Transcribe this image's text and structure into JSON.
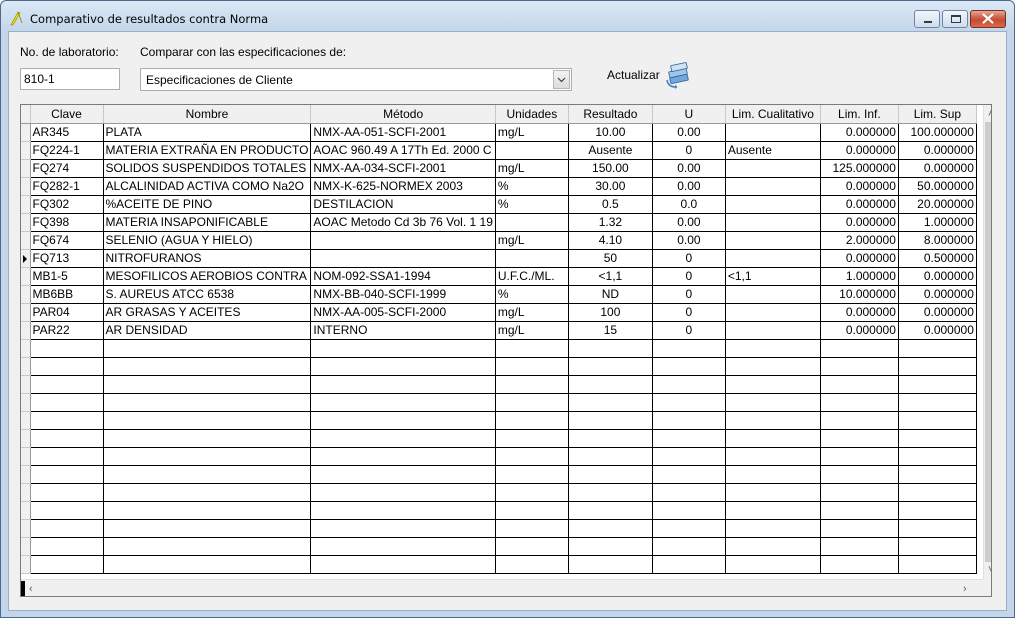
{
  "window": {
    "title": "Comparativo de resultados contra Norma"
  },
  "form": {
    "lab_label": "No. de laboratorio:",
    "lab_value": "810-1",
    "spec_label": "Comparar con las especificaciones de:",
    "spec_value": "Especificaciones de Cliente",
    "update_label": "Actualizar"
  },
  "grid": {
    "columns": [
      "Clave",
      "Nombre",
      "Método",
      "Unidades",
      "Resultado",
      "U",
      "Lim. Cualitativo",
      "Lim. Inf.",
      "Lim. Sup"
    ],
    "current_row": 7,
    "rows": [
      [
        "AR345",
        "PLATA",
        "NMX-AA-051-SCFI-2001",
        "mg/L",
        "10.00",
        "0.00",
        "",
        "0.000000",
        "100.000000"
      ],
      [
        "FQ224-1",
        "MATERIA EXTRAÑA EN PRODUCTO",
        "AOAC 960.49 A 17Th Ed. 2000 C",
        "",
        "Ausente",
        "0",
        "Ausente",
        "0.000000",
        "0.000000"
      ],
      [
        "FQ274",
        "SOLIDOS SUSPENDIDOS TOTALES",
        "NMX-AA-034-SCFI-2001",
        "mg/L",
        "150.00",
        "0.00",
        "",
        "125.000000",
        "0.000000"
      ],
      [
        "FQ282-1",
        "ALCALINIDAD ACTIVA COMO Na2O",
        "NMX-K-625-NORMEX 2003",
        "%",
        "30.00",
        "0.00",
        "",
        "0.000000",
        "50.000000"
      ],
      [
        "FQ302",
        "%ACEITE DE PINO",
        "DESTILACION",
        "%",
        "0.5",
        "0.0",
        "",
        "0.000000",
        "20.000000"
      ],
      [
        "FQ398",
        "MATERIA INSAPONIFICABLE",
        "AOAC Metodo Cd 3b 76 Vol. 1 19",
        "",
        "1.32",
        "0.00",
        "",
        "0.000000",
        "1.000000"
      ],
      [
        "FQ674",
        "SELENIO (AGUA Y HIELO)",
        "",
        "mg/L",
        "4.10",
        "0.00",
        "",
        "2.000000",
        "8.000000"
      ],
      [
        "FQ713",
        "NITROFURANOS",
        "",
        "",
        "50",
        "0",
        "",
        "0.000000",
        "0.500000"
      ],
      [
        "MB1-5",
        "MESOFILICOS AEROBIOS CONTRA",
        "NOM-092-SSA1-1994",
        "U.F.C./ML.",
        "<1,1",
        "0",
        "<1,1",
        "1.000000",
        "0.000000"
      ],
      [
        "MB6BB",
        "S. AUREUS ATCC 6538",
        "NMX-BB-040-SCFI-1999",
        "%",
        "ND",
        "0",
        "",
        "10.000000",
        "0.000000"
      ],
      [
        "PAR04",
        "AR GRASAS Y ACEITES",
        "NMX-AA-005-SCFI-2000",
        "mg/L",
        "100",
        "0",
        "",
        "0.000000",
        "0.000000"
      ],
      [
        "PAR22",
        "AR DENSIDAD",
        "INTERNO",
        "mg/L",
        "15",
        "0",
        "",
        "0.000000",
        "0.000000"
      ]
    ],
    "empty_rows": 13
  },
  "icons": {
    "app": "pencil-icon",
    "update": "refresh-books-icon"
  }
}
